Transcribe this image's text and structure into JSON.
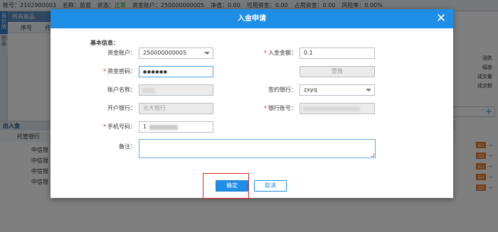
{
  "topbar": {
    "account": "账号：2102900003",
    "name": "名称：苗苗",
    "status_label": "状态：",
    "status_value": "正常",
    "fund_account": "资金账户：250000000005",
    "net_value": "净值：0.00",
    "available": "可用资金：0.00",
    "occupied": "占用资金：0.00",
    "risk": "风险率：0.00%"
  },
  "side_tabs": [
    "报价牌",
    "图表"
  ],
  "goods_panel": {
    "title": "所有商品",
    "col_seq": "序号",
    "col_code": "代"
  },
  "right_panel": {
    "labels": [
      "涨跌",
      "幅度",
      "成交量",
      "成交额"
    ]
  },
  "deposit_panel": {
    "title": "出入金",
    "col_bank": "托管银行",
    "banks": [
      "中信银",
      "中信银",
      "中信银",
      "中信银"
    ],
    "pending_dash": "--",
    "pending_badges": [
      "出1",
      "出2",
      "出3",
      "出4",
      "出5"
    ]
  },
  "modal": {
    "title": "入金申请",
    "close_symbol": "✕",
    "section_title": "基本信息：",
    "required_mark": "*",
    "fund_account_label": "资金账户：",
    "fund_account_value": "250000000005",
    "deposit_amount_label": "入金金额：",
    "deposit_amount_value": "0.1",
    "fund_password_label": "资金密码：",
    "fund_password_value": "●●●●●●",
    "amount_uppercase_value": "壹角",
    "account_name_label": "账户名称：",
    "signing_bank_label": "签约银行：",
    "signing_bank_value": "zxyq",
    "opening_bank_label": "开户银行：",
    "opening_bank_value": "光大银行",
    "bank_account_label": "银行账号：",
    "phone_label": "手机号码：",
    "phone_value": "1",
    "remark_label": "备注：",
    "confirm_label": "确定",
    "cancel_label": "取消"
  },
  "colors": {
    "header_blue": "#1e8ee6",
    "required_red": "#e02020",
    "status_green": "#1a9d3a",
    "highlight_red": "#e02020"
  }
}
